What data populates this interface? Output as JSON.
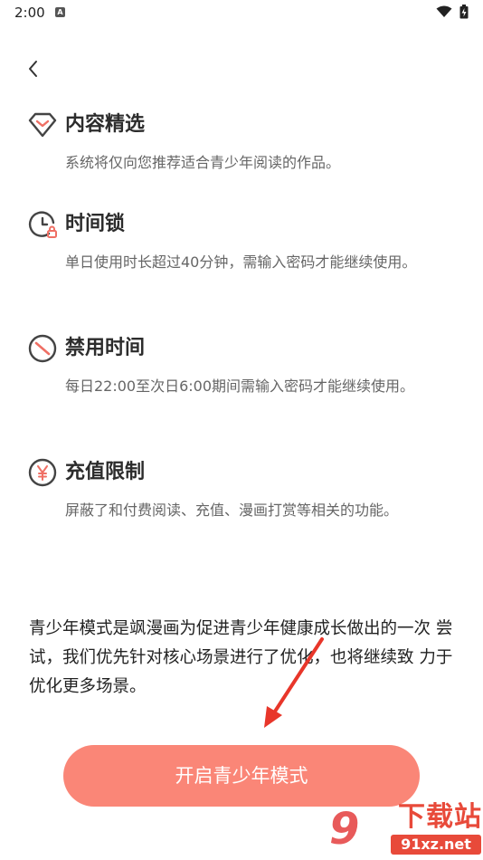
{
  "status_bar": {
    "time": "2:00",
    "app_icon_letter": "A"
  },
  "features": [
    {
      "icon": "diamond-icon",
      "title": "内容精选",
      "desc": "系统将仅向您推荐适合青少年阅读的作品。"
    },
    {
      "icon": "clock-lock-icon",
      "title": "时间锁",
      "desc": "单日使用时长超过40分钟，需输入密码才能继续使用。"
    },
    {
      "icon": "forbidden-icon",
      "title": "禁用时间",
      "desc": "每日22:00至次日6:00期间需输入密码才能继续使用。"
    },
    {
      "icon": "yen-icon",
      "title": "充值限制",
      "desc": "屏蔽了和付费阅读、充值、漫画打赏等相关的功能。"
    }
  ],
  "intro": "青少年模式是飒漫画为促进青少年健康成长做出的一次 尝试，我们优先针对核心场景进行了优化，也将继续致 力于优化更多场景。",
  "enable_button": "开启青少年模式",
  "watermark": {
    "logo": "9",
    "title": "下载站",
    "domain": "91xz.net"
  },
  "colors": {
    "accent": "#fa8677",
    "icon_stroke": "#444444",
    "icon_accent": "#ef6f64",
    "watermark": "#e84a3a"
  }
}
